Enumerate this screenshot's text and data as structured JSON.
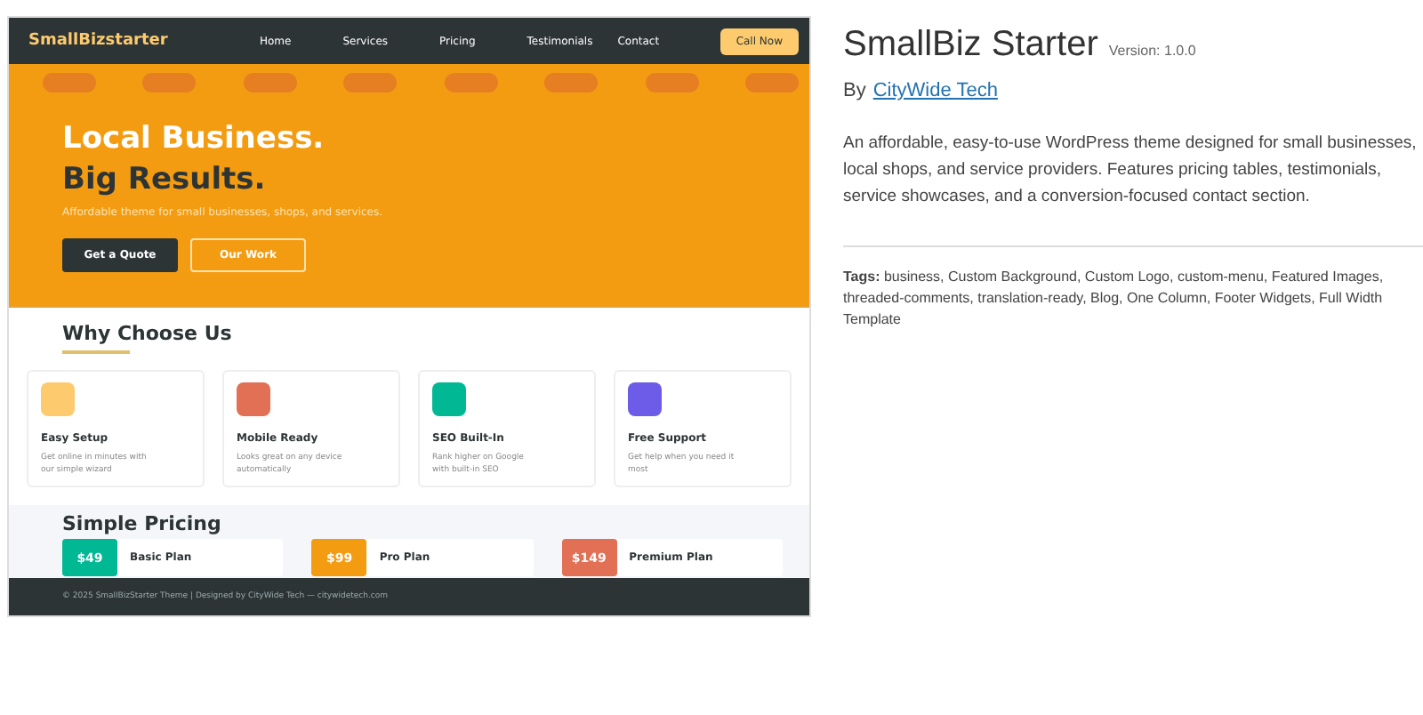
{
  "preview": {
    "logo": "SmallBizstarter",
    "nav": [
      "Home",
      "Services",
      "Pricing",
      "Testimonials",
      "Contact"
    ],
    "call_button": "Call Now",
    "hero": {
      "line_1": "Local Business.",
      "line_2": "Big Results.",
      "tagline": "Affordable theme for small businesses, shops, and services.",
      "buttons": [
        {
          "label": "Get a Quote",
          "kind": "solid"
        },
        {
          "label": "Our Work",
          "kind": "outline"
        }
      ]
    },
    "why": {
      "title": "Why Choose Us",
      "features": [
        {
          "title": "Easy Setup",
          "text": "Get online in minutes with our simple wizard",
          "color": "#fdcb6e"
        },
        {
          "title": "Mobile Ready",
          "text": "Looks great on any device automatically",
          "color": "#e17055"
        },
        {
          "title": "SEO Built-In",
          "text": "Rank higher on Google with built-in SEO",
          "color": "#00b894"
        },
        {
          "title": "Free Support",
          "text": "Get help when you need it most",
          "color": "#6c5ce7"
        }
      ]
    },
    "pricing": {
      "title": "Simple Pricing",
      "plans": [
        {
          "price": "$49",
          "name": "Basic Plan",
          "color": "#00b894"
        },
        {
          "price": "$99",
          "name": "Pro Plan",
          "color": "#f39c12"
        },
        {
          "price": "$149",
          "name": "Premium Plan",
          "color": "#e17055"
        }
      ]
    },
    "footer": "© 2025 SmallBizStarter Theme | Designed by CityWide Tech — citywidetech.com"
  },
  "details": {
    "title": "SmallBiz Starter",
    "version": "Version: 1.0.0",
    "by": "By",
    "author": "CityWide Tech",
    "description": "An affordable, easy-to-use WordPress theme designed for small businesses, local shops, and service providers. Features pricing tables, testimonials, service showcases, and a conversion-focused contact section.",
    "tags": "**Tags:** business, Custom Background, Custom Logo, custom-menu, Featured Images, threaded-comments, translation-ready, Blog, One Column, Footer Widgets, Full Width Template"
  }
}
